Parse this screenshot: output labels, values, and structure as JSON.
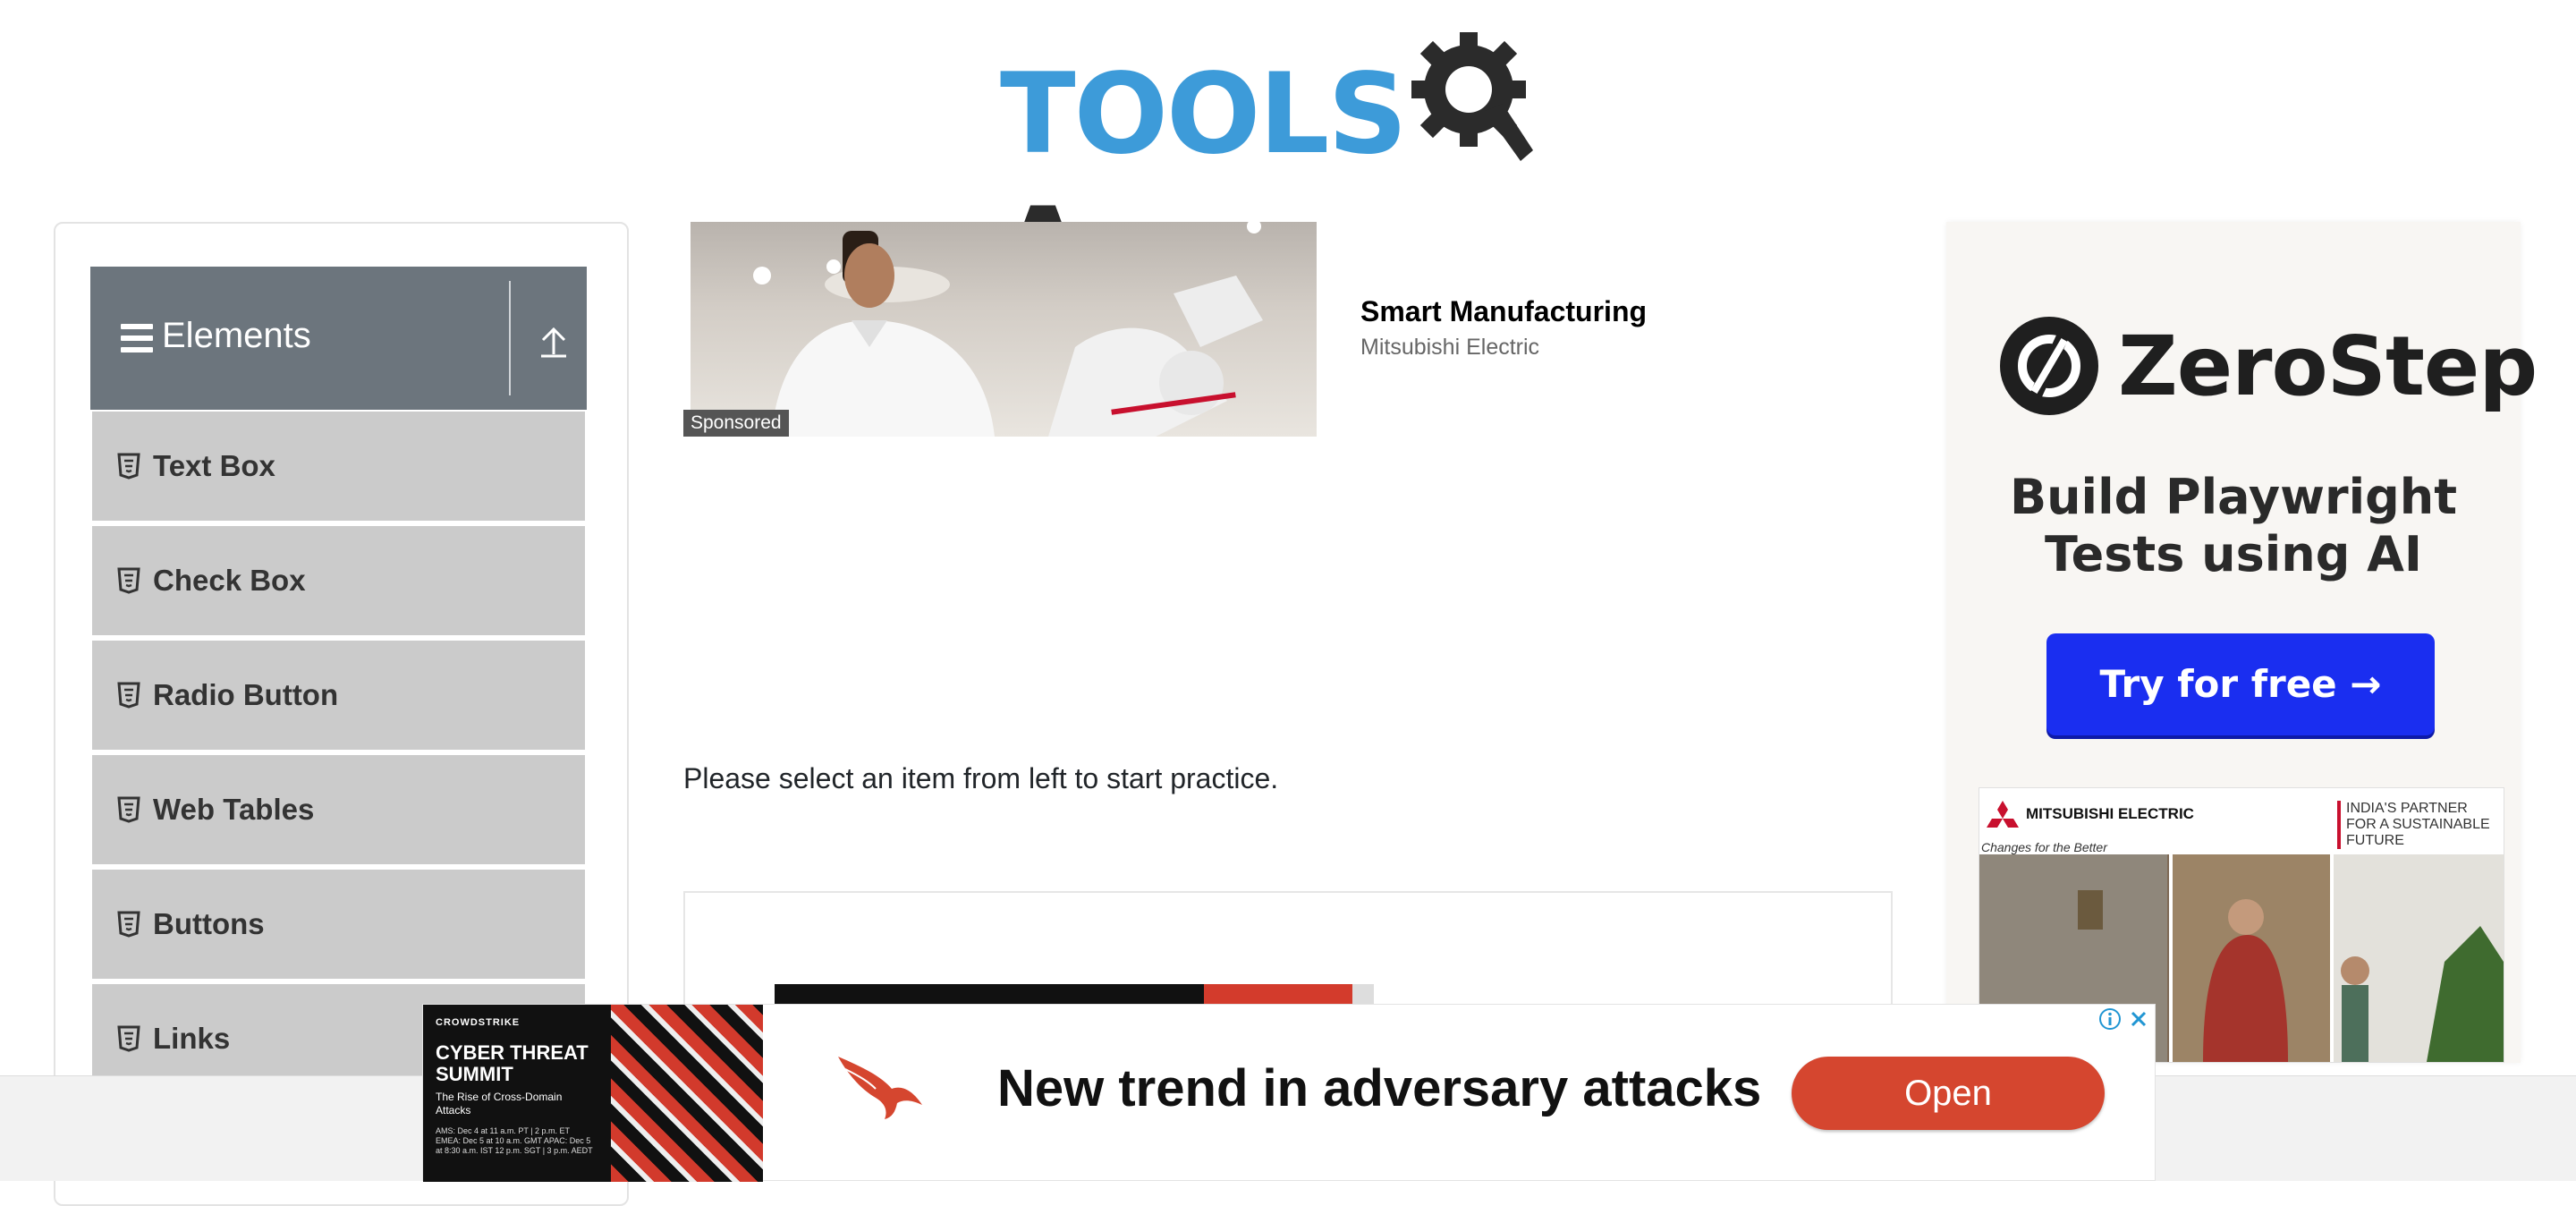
{
  "header": {
    "logo_tools": "TOOLS",
    "logo_q": "Q",
    "logo_a": "A"
  },
  "sidebar": {
    "group_title": "Elements",
    "items": [
      {
        "label": "Text Box"
      },
      {
        "label": "Check Box"
      },
      {
        "label": "Radio Button"
      },
      {
        "label": "Web Tables"
      },
      {
        "label": "Buttons"
      },
      {
        "label": "Links"
      }
    ]
  },
  "sponsored": {
    "badge": "Sponsored",
    "title": "Smart Manufacturing",
    "brand": "Mitsubishi Electric"
  },
  "main": {
    "message": "Please select an item from left to start practice."
  },
  "right_ad": {
    "brand": "ZeroStep",
    "headline_line1": "Build Playwright",
    "headline_line2": "Tests using AI",
    "cta": "Try for free →",
    "mitsubishi_logo": "MITSUBISHI ELECTRIC",
    "mitsubishi_slogan": "Changes for the Better",
    "mitsubishi_tagline": "INDIA'S PARTNER FOR A SUSTAINABLE FUTURE"
  },
  "bottom_ad": {
    "thumb_brand": "CROWDSTRIKE",
    "thumb_title": "CYBER THREAT SUMMIT",
    "thumb_sub": "The Rise of Cross-Domain Attacks",
    "thumb_dates": "AMS: Dec 4 at 11 a.m. PT | 2 p.m. ET  EMEA: Dec 5 at 10 a.m. GMT  APAC: Dec 5 at 8:30 a.m. IST 12 p.m. SGT | 3 p.m. AEDT",
    "headline": "New trend in adversary attacks",
    "cta": "Open"
  },
  "colors": {
    "logo_blue": "#3d9bd9",
    "group_header_bg": "#6c757d",
    "menu_item_bg": "#cbcbcb",
    "zerostep_cta_bg": "#1a2ef0",
    "open_button_bg": "#d5462f"
  },
  "icons": {
    "menu": "hamburger-icon",
    "collapse": "upload-arrow-icon",
    "item": "html5-icon",
    "ad_info": "info-icon",
    "ad_close": "close-icon"
  }
}
